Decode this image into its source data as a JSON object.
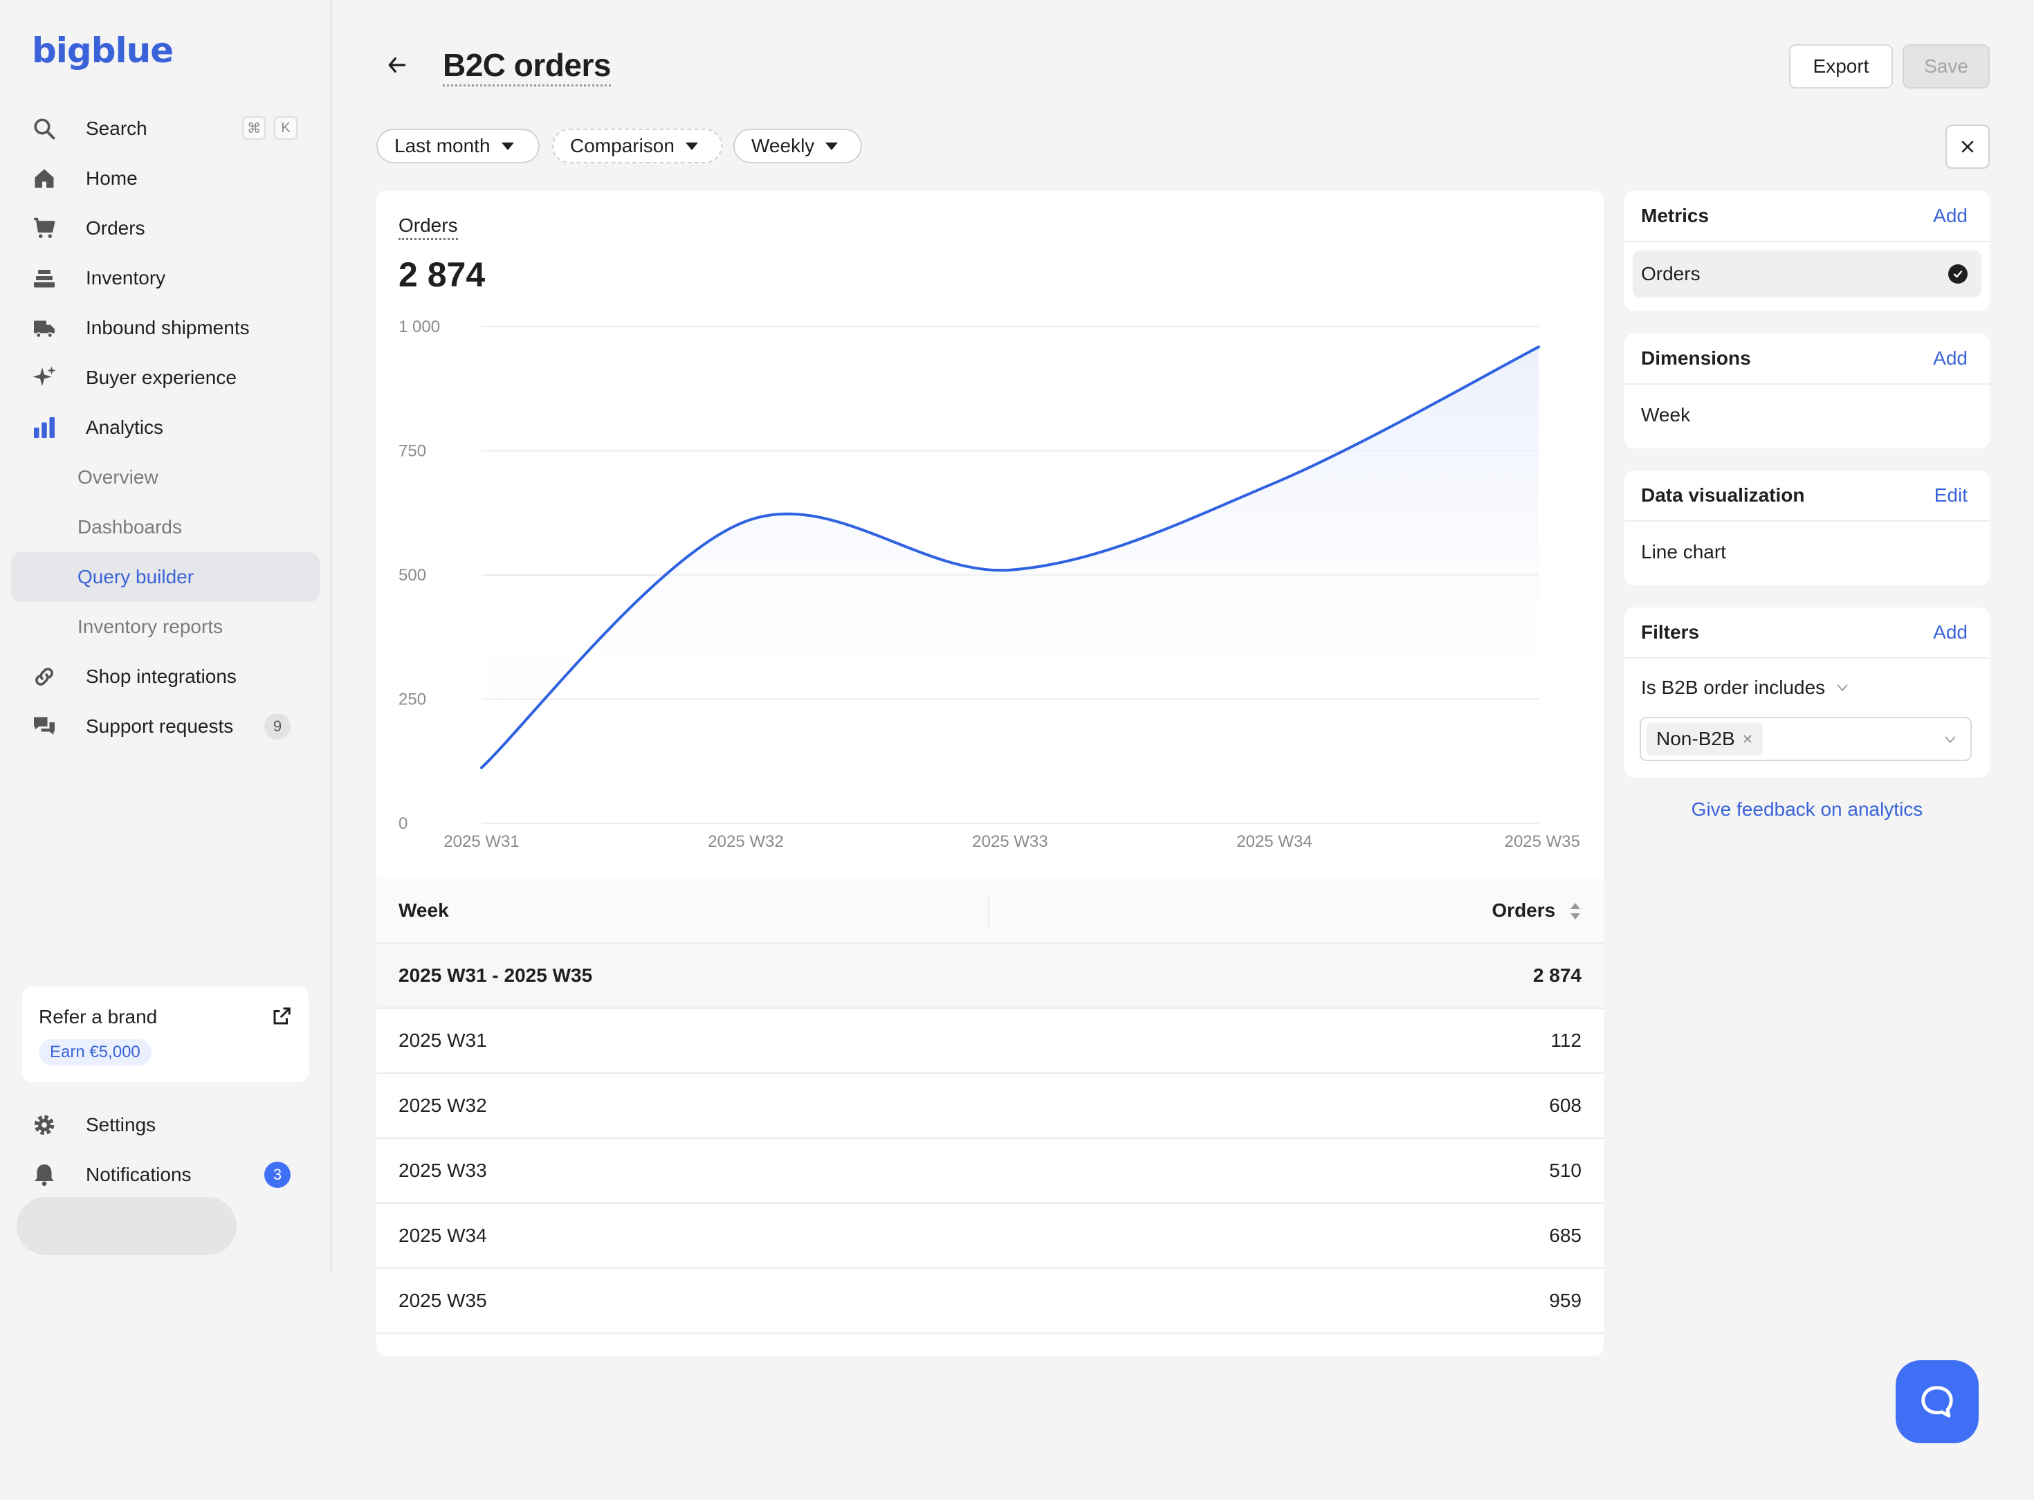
{
  "brand": {
    "logo_text": "bigblue",
    "accent": "#3b63d9"
  },
  "sidebar": {
    "search": {
      "label": "Search",
      "shortcut": [
        "⌘",
        "K"
      ]
    },
    "items": [
      {
        "label": "Home",
        "icon": "home-icon"
      },
      {
        "label": "Orders",
        "icon": "cart-icon"
      },
      {
        "label": "Inventory",
        "icon": "boxes-icon"
      },
      {
        "label": "Inbound shipments",
        "icon": "truck-icon"
      },
      {
        "label": "Buyer experience",
        "icon": "sparkle-icon"
      },
      {
        "label": "Analytics",
        "icon": "bar-chart-icon"
      }
    ],
    "analytics_sub": [
      {
        "label": "Overview"
      },
      {
        "label": "Dashboards"
      },
      {
        "label": "Query builder",
        "active": true
      },
      {
        "label": "Inventory reports"
      }
    ],
    "shop_integrations": {
      "label": "Shop integrations",
      "icon": "link-icon"
    },
    "support_requests": {
      "label": "Support requests",
      "icon": "chat-icon",
      "count": "9"
    },
    "refer": {
      "title": "Refer a brand",
      "badge": "Earn €5,000"
    },
    "settings": {
      "label": "Settings",
      "icon": "gear-icon"
    },
    "notifications": {
      "label": "Notifications",
      "icon": "bell-icon",
      "count": "3"
    }
  },
  "header": {
    "title": "B2C orders",
    "export_label": "Export",
    "save_label": "Save"
  },
  "filters_bar": {
    "date_range": "Last month",
    "comparison": "Comparison",
    "granularity": "Weekly"
  },
  "metric": {
    "label": "Orders",
    "value": "2 874"
  },
  "chart_data": {
    "type": "line",
    "x": [
      "2025 W31",
      "2025 W32",
      "2025 W33",
      "2025 W34",
      "2025 W35"
    ],
    "series": [
      {
        "values": [
          112,
          608,
          510,
          685,
          959
        ]
      }
    ],
    "y_ticks": [
      "0",
      "250",
      "500",
      "750",
      "1 000"
    ],
    "ylim": [
      0,
      1000
    ],
    "grid": true,
    "line_color": "#2f62e0"
  },
  "table": {
    "headers": [
      "Week",
      "Orders"
    ],
    "summary": [
      "2025 W31 - 2025 W35",
      "2 874"
    ],
    "rows": [
      [
        "2025 W31",
        "112"
      ],
      [
        "2025 W32",
        "608"
      ],
      [
        "2025 W33",
        "510"
      ],
      [
        "2025 W34",
        "685"
      ],
      [
        "2025 W35",
        "959"
      ]
    ]
  },
  "panels": {
    "metrics": {
      "title": "Metrics",
      "action": "Add",
      "item": "Orders"
    },
    "dimensions": {
      "title": "Dimensions",
      "action": "Add",
      "item": "Week"
    },
    "data_viz": {
      "title": "Data visualization",
      "action": "Edit",
      "item": "Line chart"
    },
    "filters": {
      "title": "Filters",
      "action": "Add",
      "condition": "Is B2B order includes",
      "tag": "Non-B2B"
    }
  },
  "feedback_link": "Give feedback on analytics"
}
